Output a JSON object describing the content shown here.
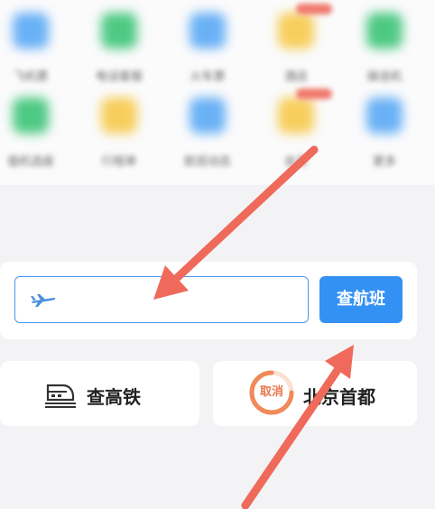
{
  "grid": {
    "row1": [
      {
        "label": "飞机票",
        "icon": "plane-icon",
        "color": "#5aa9f5",
        "badge": false
      },
      {
        "label": "电话客服",
        "icon": "phone-icon",
        "color": "#3cc477",
        "badge": false
      },
      {
        "label": "火车票",
        "icon": "train-icon",
        "color": "#5aa9f5",
        "badge": false
      },
      {
        "label": "酒店",
        "icon": "hotel-icon",
        "color": "#f7c94a",
        "badge": true
      },
      {
        "label": "接送机",
        "icon": "car-icon",
        "color": "#3cc477",
        "badge": false
      }
    ],
    "row2": [
      {
        "label": "值机选座",
        "icon": "seat-icon",
        "color": "#3cc477",
        "badge": false
      },
      {
        "label": "行程单",
        "icon": "document-icon",
        "color": "#f7c94a",
        "badge": false
      },
      {
        "label": "航班动态",
        "icon": "globe-icon",
        "color": "#5aa9f5",
        "badge": false
      },
      {
        "label": "会员",
        "icon": "heart-icon",
        "color": "#f7c94a",
        "badge": true
      },
      {
        "label": "更多",
        "icon": "grid-icon",
        "color": "#5aa9f5",
        "badge": false
      }
    ]
  },
  "search": {
    "placeholder": "",
    "button_label": "查航班"
  },
  "rail": {
    "label": "查高铁",
    "icon": "train-icon"
  },
  "flight": {
    "cancel_label": "取消",
    "label": "北京首都"
  },
  "colors": {
    "accent": "#3491f4",
    "arrow": "#ef6a5a",
    "cancel": "#e8764a"
  }
}
